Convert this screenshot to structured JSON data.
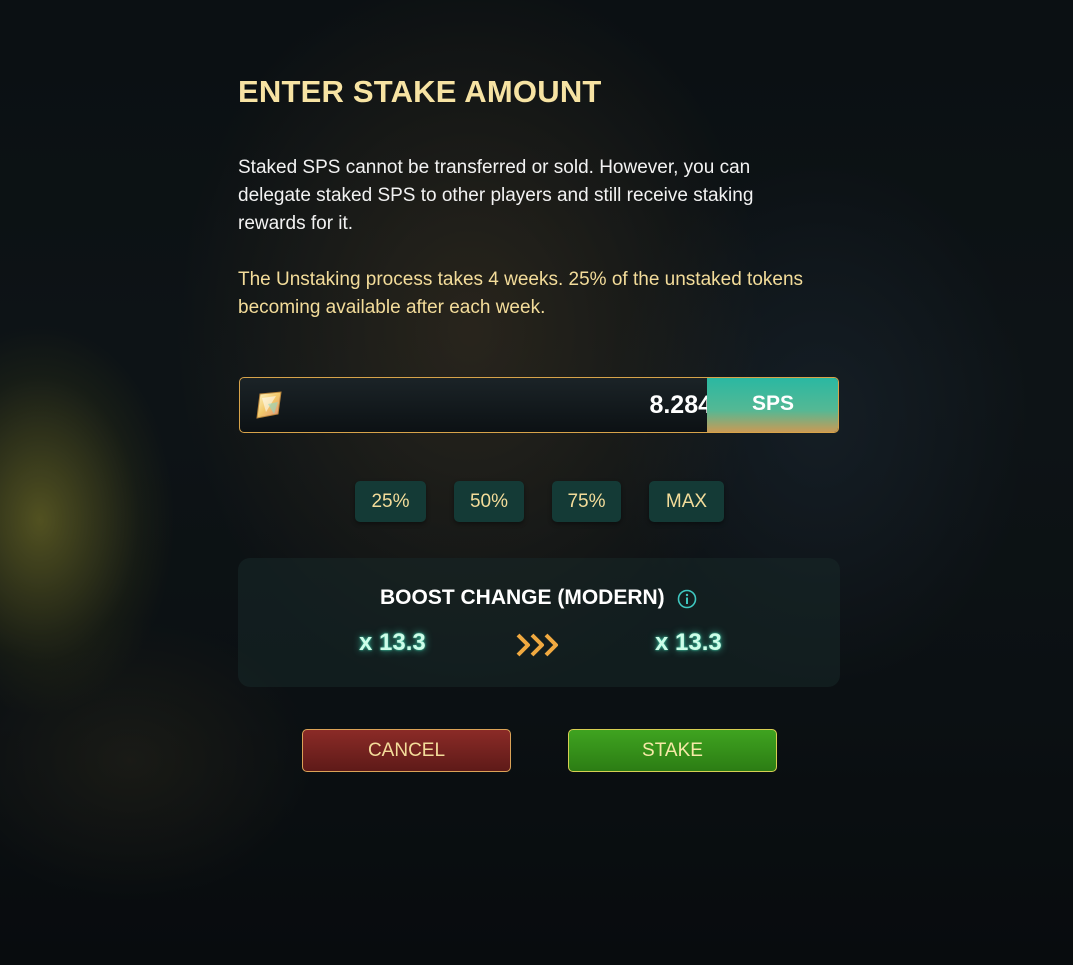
{
  "dialog": {
    "title": "ENTER STAKE AMOUNT",
    "info_text": "Staked SPS cannot be transferred or sold. However, you can delegate staked SPS to other players and still receive staking rewards for it.",
    "unstake_note": "The Unstaking process takes 4 weeks. 25% of the unstaked tokens becoming available after each week."
  },
  "amount_field": {
    "icon": "sps-token-icon",
    "value": "8.284",
    "currency": "SPS"
  },
  "percent_buttons": [
    "25%",
    "50%",
    "75%",
    "MAX"
  ],
  "boost": {
    "title": "BOOST CHANGE (MODERN)",
    "info_icon": "info-icon",
    "current": "x 13.3",
    "arrow_icon": "triple-chevron-right-icon",
    "new": "x 13.3"
  },
  "actions": {
    "cancel_label": "CANCEL",
    "stake_label": "STAKE"
  },
  "colors": {
    "title_gold": "#f7e3a3",
    "accent_teal": "#2ab8a2",
    "cancel_red": "#8b2b27",
    "stake_green": "#3fa320",
    "border_gold": "#d7a34a"
  }
}
